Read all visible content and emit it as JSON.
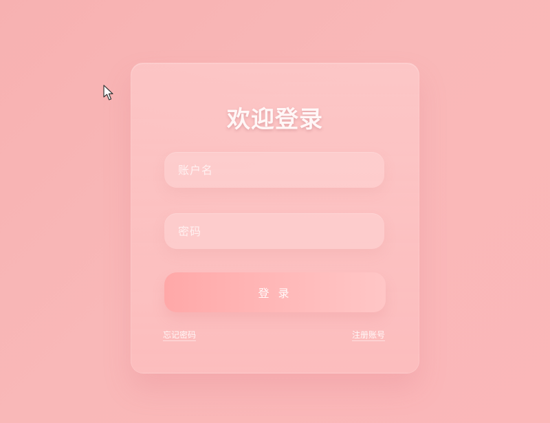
{
  "login": {
    "title": "欢迎登录",
    "username_placeholder": "账户名",
    "password_placeholder": "密码",
    "submit_label": "登 录",
    "forgot_password_label": "忘记密码",
    "register_label": "注册账号"
  },
  "icons": {
    "cursor": "mouse-cursor-icon"
  },
  "colors": {
    "background_start": "#f7b1b1",
    "background_end": "#fbb7b9",
    "card": "#ffd2d2",
    "button_start": "#ffa8a8",
    "button_end": "#ffc6c6"
  }
}
